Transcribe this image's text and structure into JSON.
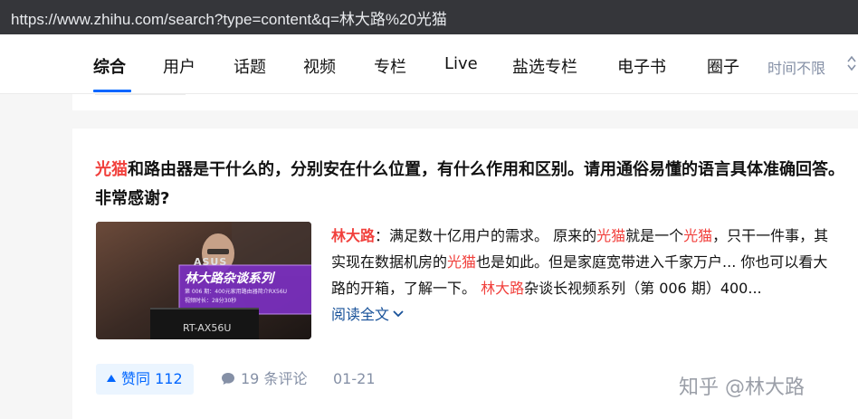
{
  "browser": {
    "url": "https://www.zhihu.com/search?type=content&q=林大路%20光猫"
  },
  "tabs": [
    {
      "label": "综合",
      "active": true
    },
    {
      "label": "用户"
    },
    {
      "label": "话题"
    },
    {
      "label": "视频"
    },
    {
      "label": "专栏"
    },
    {
      "label": "Live"
    },
    {
      "label": "盐选专栏"
    },
    {
      "label": "电子书"
    },
    {
      "label": "圈子"
    }
  ],
  "filter": {
    "label": "时间不限"
  },
  "result": {
    "title_hl": "光猫",
    "title_rest": "和路由器是干什么的，分别安在什么位置，有什么作用和区别。请用通俗易懂的语言具体准确回答。非常感谢?",
    "thumbnail": {
      "brand": "ASUS",
      "series_title": "林大路杂谈系列",
      "episode": "第 006 期：400元家用路由器简介RX56U",
      "duration": "视频时长：28分30秒",
      "box_text": "RT-AX56U"
    },
    "excerpt": {
      "author": "林大路",
      "p1": "：满足数十亿用户的需求。 原来的",
      "hl1": "光猫",
      "p2": "就是一个",
      "hl2": "光猫",
      "p3": "，只干一件事，其实现在数据机房的",
      "hl3": "光猫",
      "p4": "也是如此。但是家庭宽带进入千家万户... 你也可以看大路的开箱，了解一下。 ",
      "hl4": "林大路",
      "p5": "杂谈长视频系列（第 006 期）400... ",
      "read_more": "阅读全文"
    },
    "vote_label": "赞同 112",
    "comments_label": "19 条评论",
    "date": "01-21"
  },
  "watermark": "知乎 @林大路",
  "colors": {
    "accent": "#0066ff",
    "highlight": "#f1403c",
    "meta": "#8590a6",
    "link": "#175199"
  }
}
